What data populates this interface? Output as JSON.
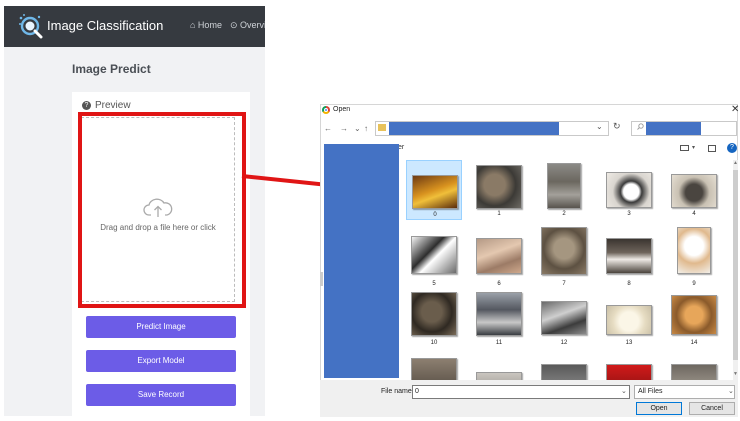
{
  "app": {
    "title": "Image Classification",
    "nav": {
      "home": "⌂ Home",
      "overview": "⊙ Overvi"
    },
    "page_title": "Image Predict",
    "preview": {
      "icon": "question-circle-icon",
      "label": "Preview"
    },
    "dropzone": {
      "icon": "cloud-upload-icon",
      "text": "Drag and drop a file here or click"
    },
    "buttons": {
      "predict": "Predict Image",
      "export": "Export Model",
      "save": "Save Record"
    },
    "colors": {
      "navbar": "#363a40",
      "button": "#6c5ce7",
      "highlight": "#e01515"
    }
  },
  "dialog": {
    "title": "Open",
    "close": "✕",
    "nav": {
      "back": "←",
      "forward": "→",
      "recent": "⌄",
      "up": "↑"
    },
    "address": {
      "dropdown": "⌄",
      "refresh": "↻"
    },
    "search": {
      "icon": "search-icon"
    },
    "toolbar": {
      "cut_label": "er"
    },
    "files": [
      {
        "name": "0",
        "selected": true
      },
      {
        "name": "1"
      },
      {
        "name": "2"
      },
      {
        "name": "3"
      },
      {
        "name": "4"
      },
      {
        "name": "5"
      },
      {
        "name": "6"
      },
      {
        "name": "7"
      },
      {
        "name": "8"
      },
      {
        "name": "9"
      },
      {
        "name": "10"
      },
      {
        "name": "11"
      },
      {
        "name": "12"
      },
      {
        "name": "13"
      },
      {
        "name": "14"
      },
      {
        "name": ""
      },
      {
        "name": ""
      },
      {
        "name": ""
      },
      {
        "name": ""
      },
      {
        "name": ""
      }
    ],
    "bottom": {
      "file_name_label": "File name:",
      "file_name_value": "0",
      "file_type": "All Files",
      "open": "Open",
      "cancel": "Cancel"
    },
    "colors": {
      "redaction": "#4472c4",
      "selection": "#cce8ff"
    }
  }
}
